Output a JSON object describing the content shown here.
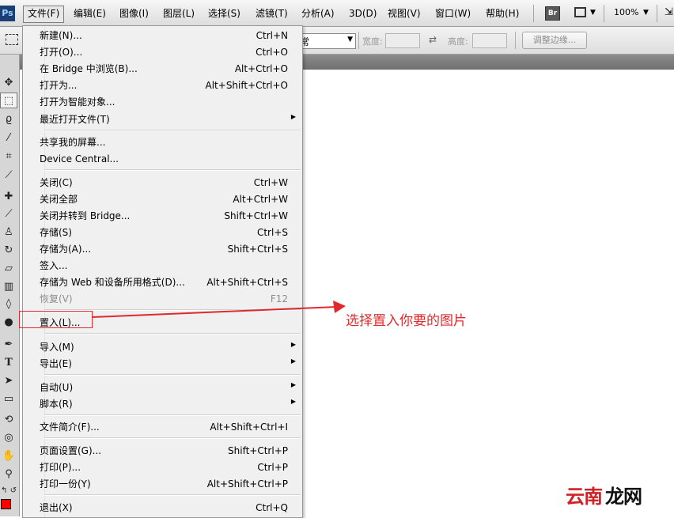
{
  "menubar": {
    "logo": "Ps",
    "items": [
      "文件(F)",
      "编辑(E)",
      "图像(I)",
      "图层(L)",
      "选择(S)",
      "滤镜(T)",
      "分析(A)",
      "3D(D)",
      "视图(V)",
      "窗口(W)",
      "帮助(H)"
    ],
    "bridge_button": "Br",
    "zoom": "100%"
  },
  "options": {
    "style_value": "常",
    "width_label": "宽度:",
    "height_label": "高度:",
    "refine_edge": "调整边缘..."
  },
  "file_menu": {
    "items": [
      {
        "label": "新建(N)...",
        "shortcut": "Ctrl+N"
      },
      {
        "label": "打开(O)...",
        "shortcut": "Ctrl+O"
      },
      {
        "label": "在 Bridge 中浏览(B)...",
        "shortcut": "Alt+Ctrl+O"
      },
      {
        "label": "打开为...",
        "shortcut": "Alt+Shift+Ctrl+O"
      },
      {
        "label": "打开为智能对象...",
        "shortcut": ""
      },
      {
        "label": "最近打开文件(T)",
        "shortcut": ""
      },
      {
        "label": "共享我的屏幕...",
        "shortcut": ""
      },
      {
        "label": "Device Central...",
        "shortcut": ""
      },
      {
        "label": "关闭(C)",
        "shortcut": "Ctrl+W"
      },
      {
        "label": "关闭全部",
        "shortcut": "Alt+Ctrl+W"
      },
      {
        "label": "关闭并转到 Bridge...",
        "shortcut": "Shift+Ctrl+W"
      },
      {
        "label": "存储(S)",
        "shortcut": "Ctrl+S"
      },
      {
        "label": "存储为(A)...",
        "shortcut": "Shift+Ctrl+S"
      },
      {
        "label": "签入...",
        "shortcut": ""
      },
      {
        "label": "存储为 Web 和设备所用格式(D)...",
        "shortcut": "Alt+Shift+Ctrl+S"
      },
      {
        "label": "恢复(V)",
        "shortcut": "F12"
      },
      {
        "label": "置入(L)...",
        "shortcut": ""
      },
      {
        "label": "导入(M)",
        "shortcut": ""
      },
      {
        "label": "导出(E)",
        "shortcut": ""
      },
      {
        "label": "自动(U)",
        "shortcut": ""
      },
      {
        "label": "脚本(R)",
        "shortcut": ""
      },
      {
        "label": "文件简介(F)...",
        "shortcut": "Alt+Shift+Ctrl+I"
      },
      {
        "label": "页面设置(G)...",
        "shortcut": "Shift+Ctrl+P"
      },
      {
        "label": "打印(P)...",
        "shortcut": "Ctrl+P"
      },
      {
        "label": "打印一份(Y)",
        "shortcut": "Alt+Shift+Ctrl+P"
      },
      {
        "label": "退出(X)",
        "shortcut": "Ctrl+Q"
      }
    ]
  },
  "annotation": {
    "text": "选择置入你要的图片",
    "color": "#e0292d"
  },
  "watermark": {
    "text_red": "云南",
    "text_black": "龙网"
  },
  "colors": {
    "foreground": "#ff0000"
  }
}
